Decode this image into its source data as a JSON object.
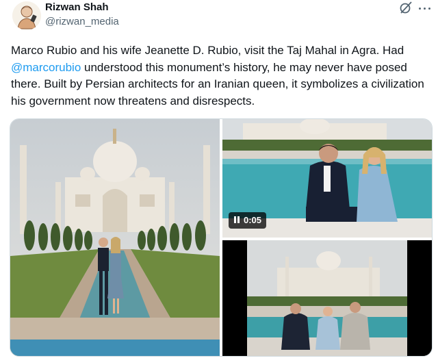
{
  "author": {
    "name": "Rizwan Shah",
    "handle": "@rizwan_media",
    "avatar_icon": "cartoon-avatar-icon"
  },
  "tweet": {
    "text_part1": "Marco Rubio and his wife Jeanette D. Rubio, visit the Taj Mahal in Agra. Had ",
    "mention": "@marcorubio",
    "text_part2": " understood this monument’s history, he may never have posed there. Built by Persian architects for an Iranian queen, it symbolizes a civilization his government now threatens and disrespects."
  },
  "media": {
    "video_duration": "0:05",
    "play_icon": "pause-icon"
  },
  "header_icons": {
    "grok": "grok-icon",
    "more": "more-options-icon"
  },
  "colors": {
    "mention": "#1d9bf0",
    "text": "#0f1419",
    "secondary": "#536471"
  }
}
